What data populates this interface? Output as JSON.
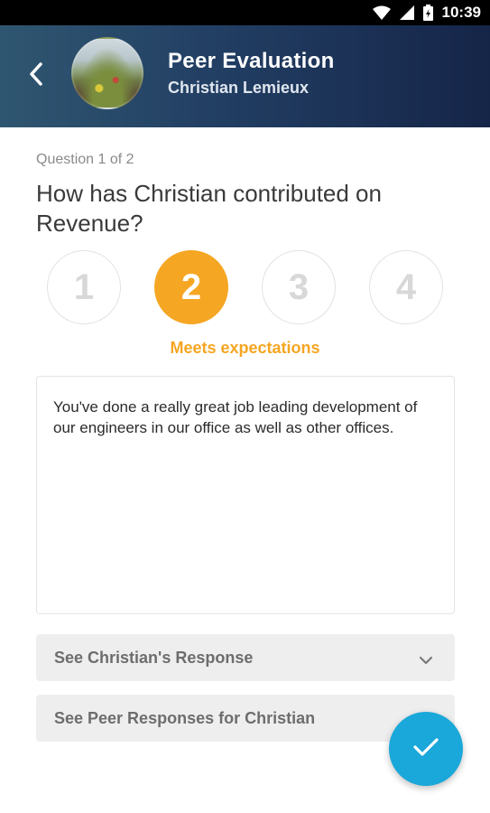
{
  "status_bar": {
    "time": "10:39",
    "icons": [
      "wifi-icon",
      "cell-signal-icon",
      "battery-icon"
    ]
  },
  "header": {
    "title": "Peer Evaluation",
    "subtitle": "Christian Lemieux",
    "back_icon": "back-arrow-icon",
    "background_colors": [
      "#2f5670",
      "#152548"
    ]
  },
  "question": {
    "counter": "Question 1 of 2",
    "text": "How has Christian contributed on Revenue?"
  },
  "rating": {
    "options": [
      "1",
      "2",
      "3",
      "4"
    ],
    "selected": "2",
    "selected_label": "Meets expectations",
    "accent_color": "#f5a623"
  },
  "comment": {
    "value": "You've done a really great job leading development of our engineers in our office as well as other offices."
  },
  "expanders": [
    {
      "label": "See Christian's Response",
      "icon": "chevron-down-icon"
    },
    {
      "label": "See Peer Responses for Christian"
    }
  ],
  "fab": {
    "icon": "checkmark-icon",
    "color": "#1aa7d9"
  }
}
